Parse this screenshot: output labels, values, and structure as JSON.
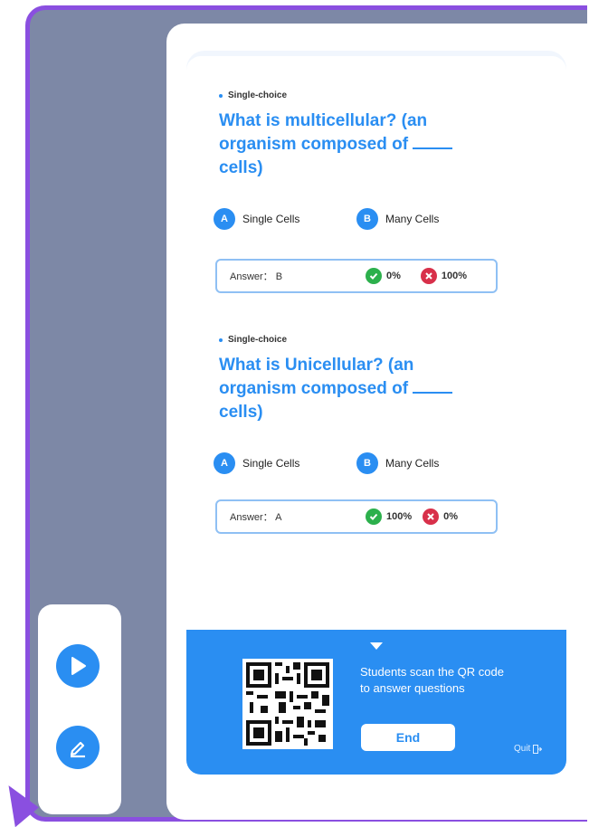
{
  "questions": [
    {
      "type_label": "Single-choice",
      "text_before": "What is multicellular?  (an organism composed of ",
      "text_after": "cells)",
      "options": [
        {
          "letter": "A",
          "label": "Single Cells"
        },
        {
          "letter": "B",
          "label": "Many Cells"
        }
      ],
      "answer": "Answer： B",
      "correct_pct": "0%",
      "wrong_pct": "100%"
    },
    {
      "type_label": "Single-choice",
      "text_before": "What is Unicellular?  (an organism composed of ",
      "text_after": "cells)",
      "options": [
        {
          "letter": "A",
          "label": "Single Cells"
        },
        {
          "letter": "B",
          "label": "Many Cells"
        }
      ],
      "answer": "Answer： A",
      "correct_pct": "100%",
      "wrong_pct": "0%"
    }
  ],
  "footer": {
    "scan_text": "Students scan the QR code to answer questions",
    "end_label": "End",
    "quit_label": "Quit"
  },
  "toolbar": {
    "play_icon": "play-icon",
    "edit_icon": "edit-icon"
  },
  "colors": {
    "accent": "#2a8ef2",
    "frame": "#8a4fe0",
    "correct": "#2cb04c",
    "wrong": "#d8304a"
  }
}
